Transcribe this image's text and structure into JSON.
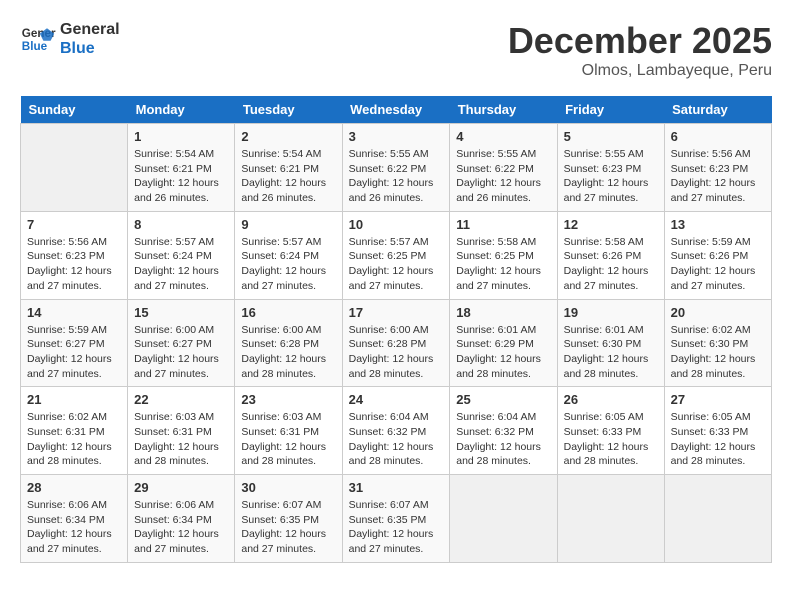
{
  "header": {
    "logo_line1": "General",
    "logo_line2": "Blue",
    "month": "December 2025",
    "location": "Olmos, Lambayeque, Peru"
  },
  "days_of_week": [
    "Sunday",
    "Monday",
    "Tuesday",
    "Wednesday",
    "Thursday",
    "Friday",
    "Saturday"
  ],
  "weeks": [
    [
      {
        "day": "",
        "info": ""
      },
      {
        "day": "1",
        "info": "Sunrise: 5:54 AM\nSunset: 6:21 PM\nDaylight: 12 hours\nand 26 minutes."
      },
      {
        "day": "2",
        "info": "Sunrise: 5:54 AM\nSunset: 6:21 PM\nDaylight: 12 hours\nand 26 minutes."
      },
      {
        "day": "3",
        "info": "Sunrise: 5:55 AM\nSunset: 6:22 PM\nDaylight: 12 hours\nand 26 minutes."
      },
      {
        "day": "4",
        "info": "Sunrise: 5:55 AM\nSunset: 6:22 PM\nDaylight: 12 hours\nand 26 minutes."
      },
      {
        "day": "5",
        "info": "Sunrise: 5:55 AM\nSunset: 6:23 PM\nDaylight: 12 hours\nand 27 minutes."
      },
      {
        "day": "6",
        "info": "Sunrise: 5:56 AM\nSunset: 6:23 PM\nDaylight: 12 hours\nand 27 minutes."
      }
    ],
    [
      {
        "day": "7",
        "info": "Sunrise: 5:56 AM\nSunset: 6:23 PM\nDaylight: 12 hours\nand 27 minutes."
      },
      {
        "day": "8",
        "info": "Sunrise: 5:57 AM\nSunset: 6:24 PM\nDaylight: 12 hours\nand 27 minutes."
      },
      {
        "day": "9",
        "info": "Sunrise: 5:57 AM\nSunset: 6:24 PM\nDaylight: 12 hours\nand 27 minutes."
      },
      {
        "day": "10",
        "info": "Sunrise: 5:57 AM\nSunset: 6:25 PM\nDaylight: 12 hours\nand 27 minutes."
      },
      {
        "day": "11",
        "info": "Sunrise: 5:58 AM\nSunset: 6:25 PM\nDaylight: 12 hours\nand 27 minutes."
      },
      {
        "day": "12",
        "info": "Sunrise: 5:58 AM\nSunset: 6:26 PM\nDaylight: 12 hours\nand 27 minutes."
      },
      {
        "day": "13",
        "info": "Sunrise: 5:59 AM\nSunset: 6:26 PM\nDaylight: 12 hours\nand 27 minutes."
      }
    ],
    [
      {
        "day": "14",
        "info": "Sunrise: 5:59 AM\nSunset: 6:27 PM\nDaylight: 12 hours\nand 27 minutes."
      },
      {
        "day": "15",
        "info": "Sunrise: 6:00 AM\nSunset: 6:27 PM\nDaylight: 12 hours\nand 27 minutes."
      },
      {
        "day": "16",
        "info": "Sunrise: 6:00 AM\nSunset: 6:28 PM\nDaylight: 12 hours\nand 28 minutes."
      },
      {
        "day": "17",
        "info": "Sunrise: 6:00 AM\nSunset: 6:28 PM\nDaylight: 12 hours\nand 28 minutes."
      },
      {
        "day": "18",
        "info": "Sunrise: 6:01 AM\nSunset: 6:29 PM\nDaylight: 12 hours\nand 28 minutes."
      },
      {
        "day": "19",
        "info": "Sunrise: 6:01 AM\nSunset: 6:30 PM\nDaylight: 12 hours\nand 28 minutes."
      },
      {
        "day": "20",
        "info": "Sunrise: 6:02 AM\nSunset: 6:30 PM\nDaylight: 12 hours\nand 28 minutes."
      }
    ],
    [
      {
        "day": "21",
        "info": "Sunrise: 6:02 AM\nSunset: 6:31 PM\nDaylight: 12 hours\nand 28 minutes."
      },
      {
        "day": "22",
        "info": "Sunrise: 6:03 AM\nSunset: 6:31 PM\nDaylight: 12 hours\nand 28 minutes."
      },
      {
        "day": "23",
        "info": "Sunrise: 6:03 AM\nSunset: 6:31 PM\nDaylight: 12 hours\nand 28 minutes."
      },
      {
        "day": "24",
        "info": "Sunrise: 6:04 AM\nSunset: 6:32 PM\nDaylight: 12 hours\nand 28 minutes."
      },
      {
        "day": "25",
        "info": "Sunrise: 6:04 AM\nSunset: 6:32 PM\nDaylight: 12 hours\nand 28 minutes."
      },
      {
        "day": "26",
        "info": "Sunrise: 6:05 AM\nSunset: 6:33 PM\nDaylight: 12 hours\nand 28 minutes."
      },
      {
        "day": "27",
        "info": "Sunrise: 6:05 AM\nSunset: 6:33 PM\nDaylight: 12 hours\nand 28 minutes."
      }
    ],
    [
      {
        "day": "28",
        "info": "Sunrise: 6:06 AM\nSunset: 6:34 PM\nDaylight: 12 hours\nand 27 minutes."
      },
      {
        "day": "29",
        "info": "Sunrise: 6:06 AM\nSunset: 6:34 PM\nDaylight: 12 hours\nand 27 minutes."
      },
      {
        "day": "30",
        "info": "Sunrise: 6:07 AM\nSunset: 6:35 PM\nDaylight: 12 hours\nand 27 minutes."
      },
      {
        "day": "31",
        "info": "Sunrise: 6:07 AM\nSunset: 6:35 PM\nDaylight: 12 hours\nand 27 minutes."
      },
      {
        "day": "",
        "info": ""
      },
      {
        "day": "",
        "info": ""
      },
      {
        "day": "",
        "info": ""
      }
    ]
  ]
}
